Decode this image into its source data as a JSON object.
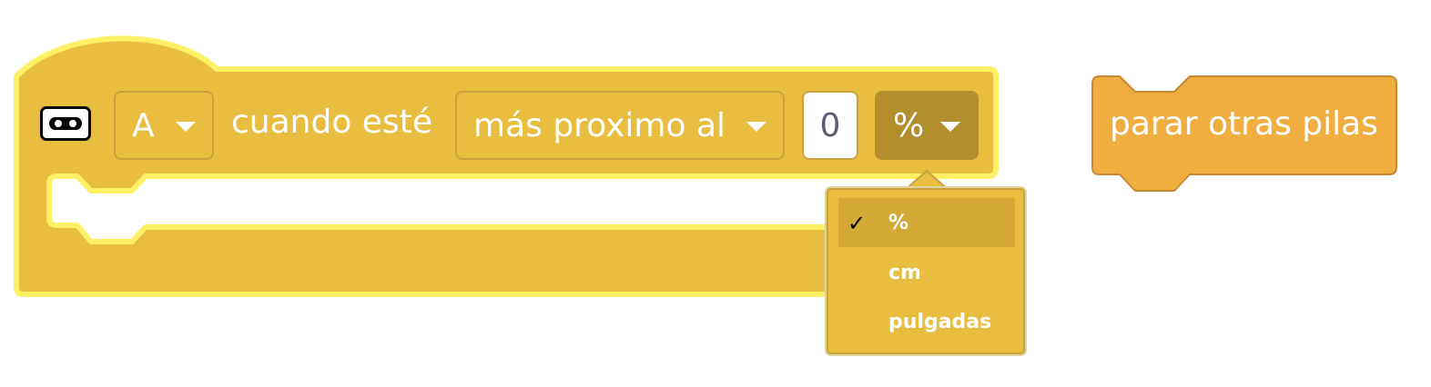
{
  "colors": {
    "block_fill": "#e9bd40",
    "block_highlight": "#fff163",
    "field_border": "#c9a23d",
    "active_field": "#b38e2d",
    "control_block_fill": "#f0ae40",
    "control_block_border": "#c88a30",
    "text": "#ffffff",
    "number_text": "#575e75"
  },
  "event_block": {
    "icon": "distance-sensor-icon",
    "port_value": "A",
    "label": "cuando esté",
    "comparison_value": "más proximo al",
    "distance_value": "0",
    "unit_value": "%"
  },
  "unit_menu": {
    "items": [
      {
        "label": "%",
        "selected": true,
        "check": "✓"
      },
      {
        "label": "cm",
        "selected": false,
        "check": ""
      },
      {
        "label": "pulgadas",
        "selected": false,
        "check": ""
      }
    ]
  },
  "control_block": {
    "label": "parar otras pilas"
  }
}
